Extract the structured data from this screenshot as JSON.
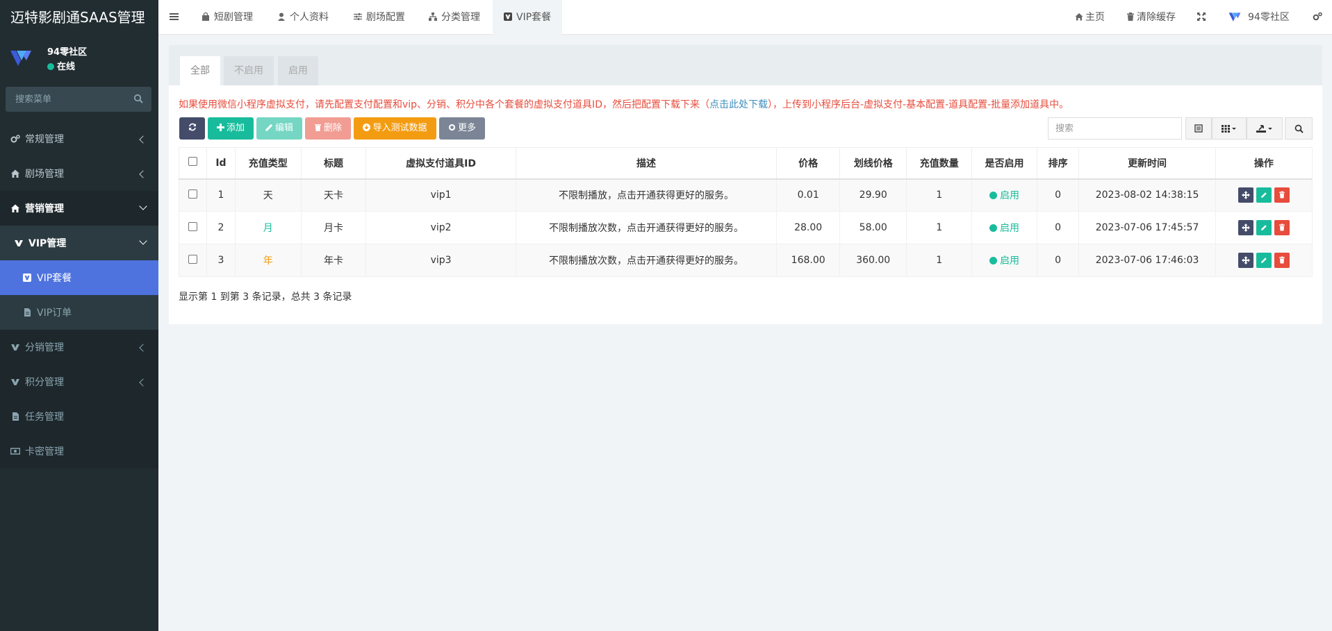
{
  "app": {
    "title": "迈特影剧通SAAS管理"
  },
  "user": {
    "name": "94零社区",
    "status": "在线"
  },
  "sidebar": {
    "search_placeholder": "搜索菜单",
    "items": [
      {
        "label": "常规管理",
        "icon": "cogs-icon"
      },
      {
        "label": "剧场管理",
        "icon": "home-icon"
      },
      {
        "label": "营销管理",
        "icon": "home-icon"
      },
      {
        "label": "VIP管理",
        "icon": "vip-icon"
      },
      {
        "label": "VIP套餐",
        "icon": "vip-icon"
      },
      {
        "label": "VIP订单",
        "icon": "file-icon"
      },
      {
        "label": "分销管理",
        "icon": "vip-icon"
      },
      {
        "label": "积分管理",
        "icon": "vip-icon"
      },
      {
        "label": "任务管理",
        "icon": "file-icon"
      },
      {
        "label": "卡密管理",
        "icon": "money-icon"
      }
    ]
  },
  "topbar": {
    "tabs": [
      {
        "label": "短剧管理"
      },
      {
        "label": "个人资料"
      },
      {
        "label": "剧场配置"
      },
      {
        "label": "分类管理"
      },
      {
        "label": "VIP套餐"
      }
    ],
    "right": {
      "home": "主页",
      "clear_cache": "清除缓存",
      "community": "94零社区"
    }
  },
  "panel": {
    "tabs": [
      "全部",
      "不启用",
      "启用"
    ],
    "notice_before": "如果使用微信小程序虚拟支付，请先配置支付配置和vip、分销、积分中各个套餐的虚拟支付道具ID，然后把配置下载下来（",
    "notice_link": "点击此处下载",
    "notice_after": "），上传到小程序后台-虚拟支付-基本配置-道具配置-批量添加道具中。",
    "buttons": {
      "add": "添加",
      "edit": "编辑",
      "delete": "删除",
      "import": "导入测试数据",
      "more": "更多"
    },
    "search_placeholder": "搜索",
    "columns": [
      "Id",
      "充值类型",
      "标题",
      "虚拟支付道具ID",
      "描述",
      "价格",
      "划线价格",
      "充值数量",
      "是否启用",
      "排序",
      "更新时间",
      "操作"
    ],
    "rows": [
      {
        "id": "1",
        "type": "天",
        "title": "天卡",
        "prop_id": "vip1",
        "desc": "不限制播放，点击开通获得更好的服务。",
        "price": "0.01",
        "strike": "29.90",
        "qty": "1",
        "enabled": "启用",
        "sort": "0",
        "updated": "2023-08-02 14:38:15"
      },
      {
        "id": "2",
        "type": "月",
        "title": "月卡",
        "prop_id": "vip2",
        "desc": "不限制播放次数，点击开通获得更好的服务。",
        "price": "28.00",
        "strike": "58.00",
        "qty": "1",
        "enabled": "启用",
        "sort": "0",
        "updated": "2023-07-06 17:45:57"
      },
      {
        "id": "3",
        "type": "年",
        "title": "年卡",
        "prop_id": "vip3",
        "desc": "不限制播放次数，点击开通获得更好的服务。",
        "price": "168.00",
        "strike": "360.00",
        "qty": "1",
        "enabled": "启用",
        "sort": "0",
        "updated": "2023-07-06 17:46:03"
      }
    ],
    "footer": "显示第 1 到第 3 条记录，总共 3 条记录"
  },
  "colors": {
    "sidebar": "#222d32",
    "selected": "#4e73df",
    "success": "#18bc9c",
    "danger": "#e74c3c",
    "warning": "#f39c12",
    "dark": "#444c69",
    "type_month": "#18bc9c",
    "type_year": "#f39c12"
  }
}
